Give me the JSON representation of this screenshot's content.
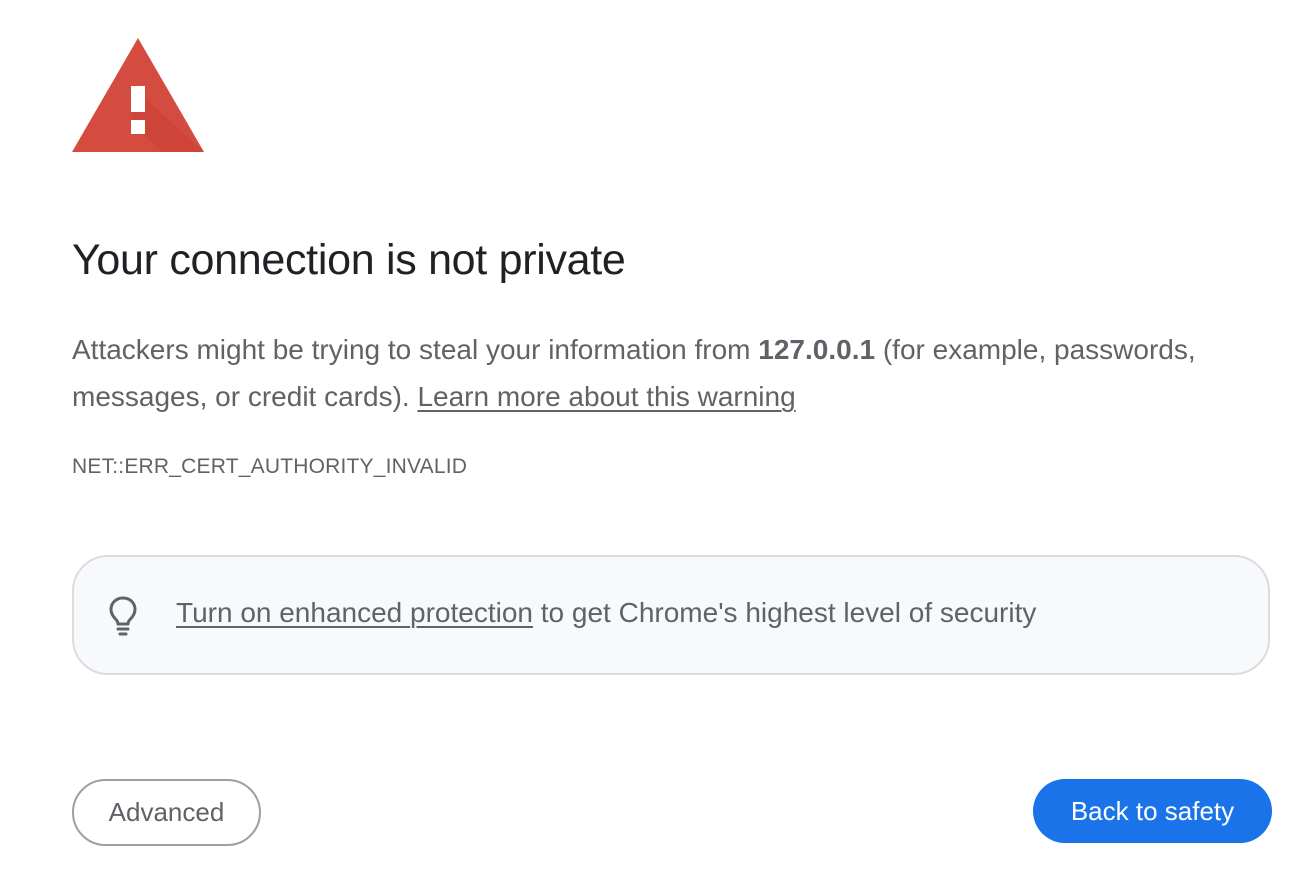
{
  "interstitial": {
    "title": "Your connection is not private",
    "body_prefix": "Attackers might be trying to steal your information from ",
    "host": "127.0.0.1",
    "body_suffix": " (for example, passwords, messages, or credit cards). ",
    "learn_more_link": "Learn more about this warning",
    "error_code": "NET::ERR_CERT_AUTHORITY_INVALID",
    "icon": "warning-triangle-icon",
    "icon_color": "#db4437"
  },
  "protection_promo": {
    "icon": "lightbulb-icon",
    "link_text": "Turn on enhanced protection",
    "suffix_text": " to get Chrome's highest level of security"
  },
  "buttons": {
    "advanced_label": "Advanced",
    "back_to_safety_label": "Back to safety",
    "primary_color": "#1a73e8"
  }
}
